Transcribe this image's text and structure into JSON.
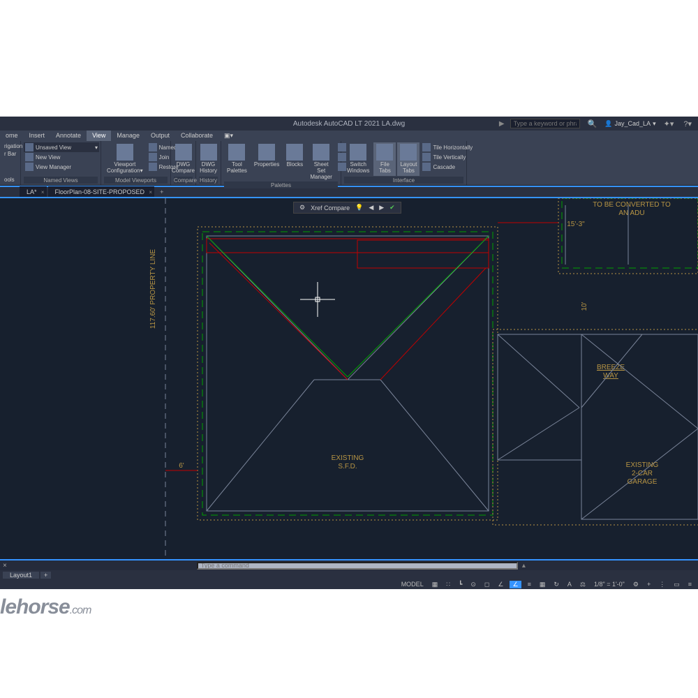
{
  "titlebar": {
    "app_title": "Autodesk AutoCAD LT 2021    LA.dwg",
    "search_placeholder": "Type a keyword or phrase",
    "user": "Jay_Cad_LA"
  },
  "menu": {
    "tabs": [
      "ome",
      "Insert",
      "Annotate",
      "View",
      "Manage",
      "Output",
      "Collaborate"
    ],
    "active": "View"
  },
  "ribbon": {
    "nav": {
      "items": [
        "rigation",
        "r Bar",
        "ools"
      ]
    },
    "views_panel": {
      "items": [
        "Unsaved View",
        "New View",
        "View Manager"
      ],
      "title": "Named Views"
    },
    "viewport_panel": {
      "buttons": [
        {
          "label": "Viewport\nConfiguration"
        },
        {
          "label": "Named",
          "sub": [
            "Join",
            "Restore"
          ]
        }
      ],
      "title": "Model Viewports"
    },
    "history_panel": {
      "buttons": [
        "DWG\nCompare",
        "DWG\nHistory"
      ],
      "title_left": "Compare",
      "title_right": "History"
    },
    "palettes_panel": {
      "buttons": [
        "Tool\nPalettes",
        "Properties",
        "Blocks",
        "Sheet Set\nManager"
      ],
      "extras": [
        "",
        "",
        "",
        ""
      ],
      "title": "Palettes"
    },
    "interface_panel": {
      "buttons": [
        "Switch\nWindows",
        "File\nTabs",
        "Layout\nTabs"
      ],
      "tiles": [
        "Tile Horizontally",
        "Tile Vertically",
        "Cascade"
      ],
      "title": "Interface"
    }
  },
  "file_tabs": {
    "tabs": [
      {
        "label": "LA*"
      },
      {
        "label": "FloorPlan-08-SITE-PROPOSED"
      }
    ]
  },
  "xref_toolbar": {
    "label": "Xref Compare"
  },
  "canvas_labels": {
    "property_line": "117.60' PROPERTY LINE",
    "six": "6'",
    "existing_sfd_1": "EXISTING",
    "existing_sfd_2": "S.F.D.",
    "dim_15_3": "15'-3\"",
    "ten": "10'",
    "breeze_1": "BREEZE",
    "breeze_2": "WAY",
    "garage_1": "EXISTING",
    "garage_2": "2-CAR",
    "garage_3": "GARAGE",
    "adu_1": "TO BE CONVERTED TO",
    "adu_2": "AN ADU"
  },
  "command": {
    "placeholder": "Type a command"
  },
  "layout": {
    "tab": "Layout1"
  },
  "status": {
    "model": "MODEL",
    "scale": "1/8\" = 1'-0\""
  },
  "watermark": {
    "text": "lehorse",
    "suffix": ".com"
  }
}
